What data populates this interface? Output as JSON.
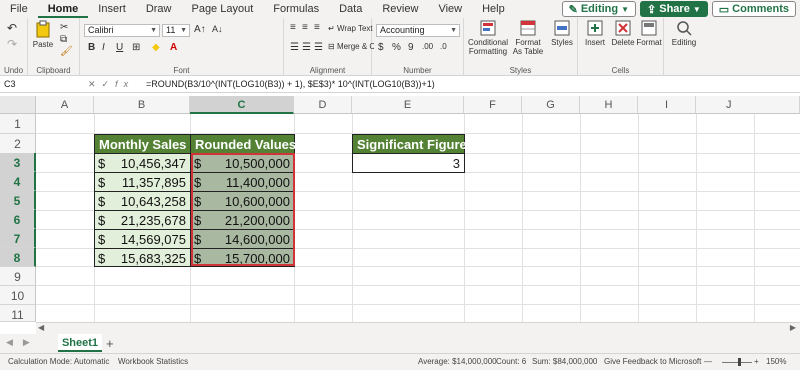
{
  "menu": {
    "items": [
      "File",
      "Home",
      "Insert",
      "Draw",
      "Page Layout",
      "Formulas",
      "Data",
      "Review",
      "View",
      "Help"
    ],
    "editing_label": "Editing",
    "share_label": "Share",
    "comments_label": "Comments"
  },
  "ribbon": {
    "undo_label": "Undo",
    "paste_label": "Paste",
    "clipboard_label": "Clipboard",
    "font_name": "Calibri",
    "font_size": "11",
    "bold": "B",
    "italic": "I",
    "underline": "U",
    "font_label": "Font",
    "wrap_text": "Wrap Text",
    "merge_center": "Merge & Center",
    "alignment_label": "Alignment",
    "number_format": "Accounting",
    "number_label": "Number",
    "conditional_formatting": "Conditional Formatting",
    "format_as_table": "Format As Table",
    "styles_btn": "Styles",
    "styles_label": "Styles",
    "insert": "Insert",
    "delete": "Delete",
    "format": "Format",
    "cells_label": "Cells",
    "editing": "Editing"
  },
  "formula_bar": {
    "name_box": "C3",
    "fx": "fx",
    "formula": "=ROUND(B3/10^(INT(LOG10(B3)) + 1), $E$3)* 10^(INT(LOG10(B3))+1)"
  },
  "columns": [
    "A",
    "B",
    "C",
    "D",
    "E",
    "F",
    "G",
    "H",
    "I",
    "J"
  ],
  "rows": [
    "1",
    "2",
    "3",
    "4",
    "5",
    "6",
    "7",
    "8",
    "9",
    "10",
    "11"
  ],
  "table": {
    "header_monthly": "Monthly Sales",
    "header_rounded": "Rounded Values",
    "currency": "$",
    "monthly_sales": [
      "10,456,347",
      "11,357,895",
      "10,643,258",
      "21,235,678",
      "14,569,075",
      "15,683,325"
    ],
    "rounded_values": [
      "10,500,000",
      "11,400,000",
      "10,600,000",
      "21,200,000",
      "14,600,000",
      "15,700,000"
    ]
  },
  "sig_figure": {
    "header": "Significant Figure",
    "value": "3"
  },
  "sheets": {
    "active": "Sheet1",
    "add": "+"
  },
  "status": {
    "calc_mode": "Calculation Mode: Automatic",
    "workbook_stats": "Workbook Statistics",
    "average": "Average: $14,000,000",
    "count": "Count: 6",
    "sum": "Sum: $84,000,000",
    "feedback": "Give Feedback to Microsoft",
    "zoom": "150%"
  },
  "colors": {
    "accent": "#217346",
    "header_fill": "#548235",
    "data_fill": "#e2efda",
    "selected_fill": "#a9b8a0",
    "selection_border": "#d13438"
  }
}
